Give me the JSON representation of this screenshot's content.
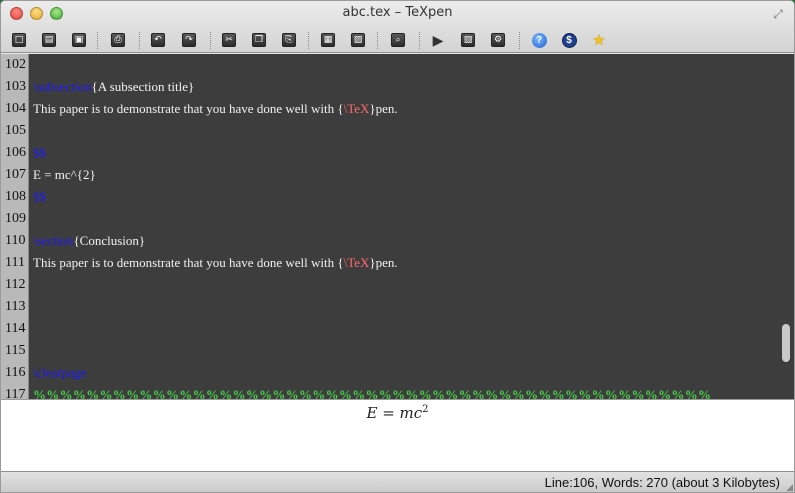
{
  "window": {
    "title": "abc.tex – TeXpen"
  },
  "toolbar": {
    "buttons": [
      {
        "name": "new-document-icon",
        "glyph": "□"
      },
      {
        "name": "open-document-icon",
        "glyph": "▤"
      },
      {
        "name": "save-document-icon",
        "glyph": "▣"
      },
      {
        "name": "print-icon",
        "glyph": "⎙"
      },
      {
        "name": "undo-icon",
        "glyph": "↶"
      },
      {
        "name": "redo-icon",
        "glyph": "↷"
      },
      {
        "name": "cut-icon",
        "glyph": "✂"
      },
      {
        "name": "copy-icon",
        "glyph": "❐"
      },
      {
        "name": "paste-icon",
        "glyph": "⎘"
      },
      {
        "name": "insert-table-icon",
        "glyph": "▦"
      },
      {
        "name": "insert-image-icon",
        "glyph": "▨"
      },
      {
        "name": "find-icon",
        "glyph": "⌕"
      },
      {
        "name": "run-icon",
        "glyph": "▶"
      },
      {
        "name": "export-icon",
        "glyph": "▧"
      },
      {
        "name": "settings-icon",
        "glyph": "⚙"
      },
      {
        "name": "help-icon",
        "glyph": "?"
      },
      {
        "name": "donate-icon",
        "glyph": "$"
      },
      {
        "name": "favorite-icon",
        "glyph": "★"
      }
    ]
  },
  "editor": {
    "lines": [
      {
        "n": "102",
        "parts": []
      },
      {
        "n": "103",
        "parts": [
          {
            "c": "kw",
            "t": "\\subsection"
          },
          {
            "c": "",
            "t": "{A subsection title}"
          }
        ]
      },
      {
        "n": "104",
        "parts": [
          {
            "c": "",
            "t": "This paper is to demonstrate that you have done well with {"
          },
          {
            "c": "tx",
            "t": "\\TeX"
          },
          {
            "c": "",
            "t": "}pen."
          }
        ]
      },
      {
        "n": "105",
        "parts": []
      },
      {
        "n": "106",
        "parts": [
          {
            "c": "kw",
            "t": "$$"
          }
        ]
      },
      {
        "n": "107",
        "parts": [
          {
            "c": "",
            "t": "E = mc^{2}"
          }
        ]
      },
      {
        "n": "108",
        "parts": [
          {
            "c": "kw",
            "t": "$$"
          }
        ]
      },
      {
        "n": "109",
        "parts": []
      },
      {
        "n": "110",
        "parts": [
          {
            "c": "kw",
            "t": "\\section"
          },
          {
            "c": "",
            "t": "{Conclusion}"
          }
        ]
      },
      {
        "n": "111",
        "parts": [
          {
            "c": "",
            "t": "This paper is to demonstrate that you have done well with {"
          },
          {
            "c": "tx",
            "t": "\\TeX"
          },
          {
            "c": "",
            "t": "}pen."
          }
        ]
      },
      {
        "n": "112",
        "parts": []
      },
      {
        "n": "113",
        "parts": []
      },
      {
        "n": "114",
        "parts": []
      },
      {
        "n": "115",
        "parts": []
      },
      {
        "n": "116",
        "parts": [
          {
            "c": "kw",
            "t": "\\clearpage"
          }
        ]
      },
      {
        "n": "117",
        "parts": [
          {
            "c": "cm",
            "t": "%%%%%%%%%%%%%%%%%%%%%%%%%%%%%%%%%%%%%%%%%%%%%%%%%%%"
          }
        ]
      }
    ]
  },
  "preview": {
    "lhs": "E",
    "eq": " = ",
    "base": "mc",
    "exp": "2"
  },
  "status": {
    "text": "Line:106, Words: 270 (about 3 Kilobytes)"
  },
  "colors": {
    "keyword": "#1a1aff",
    "tex": "#ff6a6a",
    "comment": "#46d046",
    "editor_bg": "#3d3d3d"
  }
}
